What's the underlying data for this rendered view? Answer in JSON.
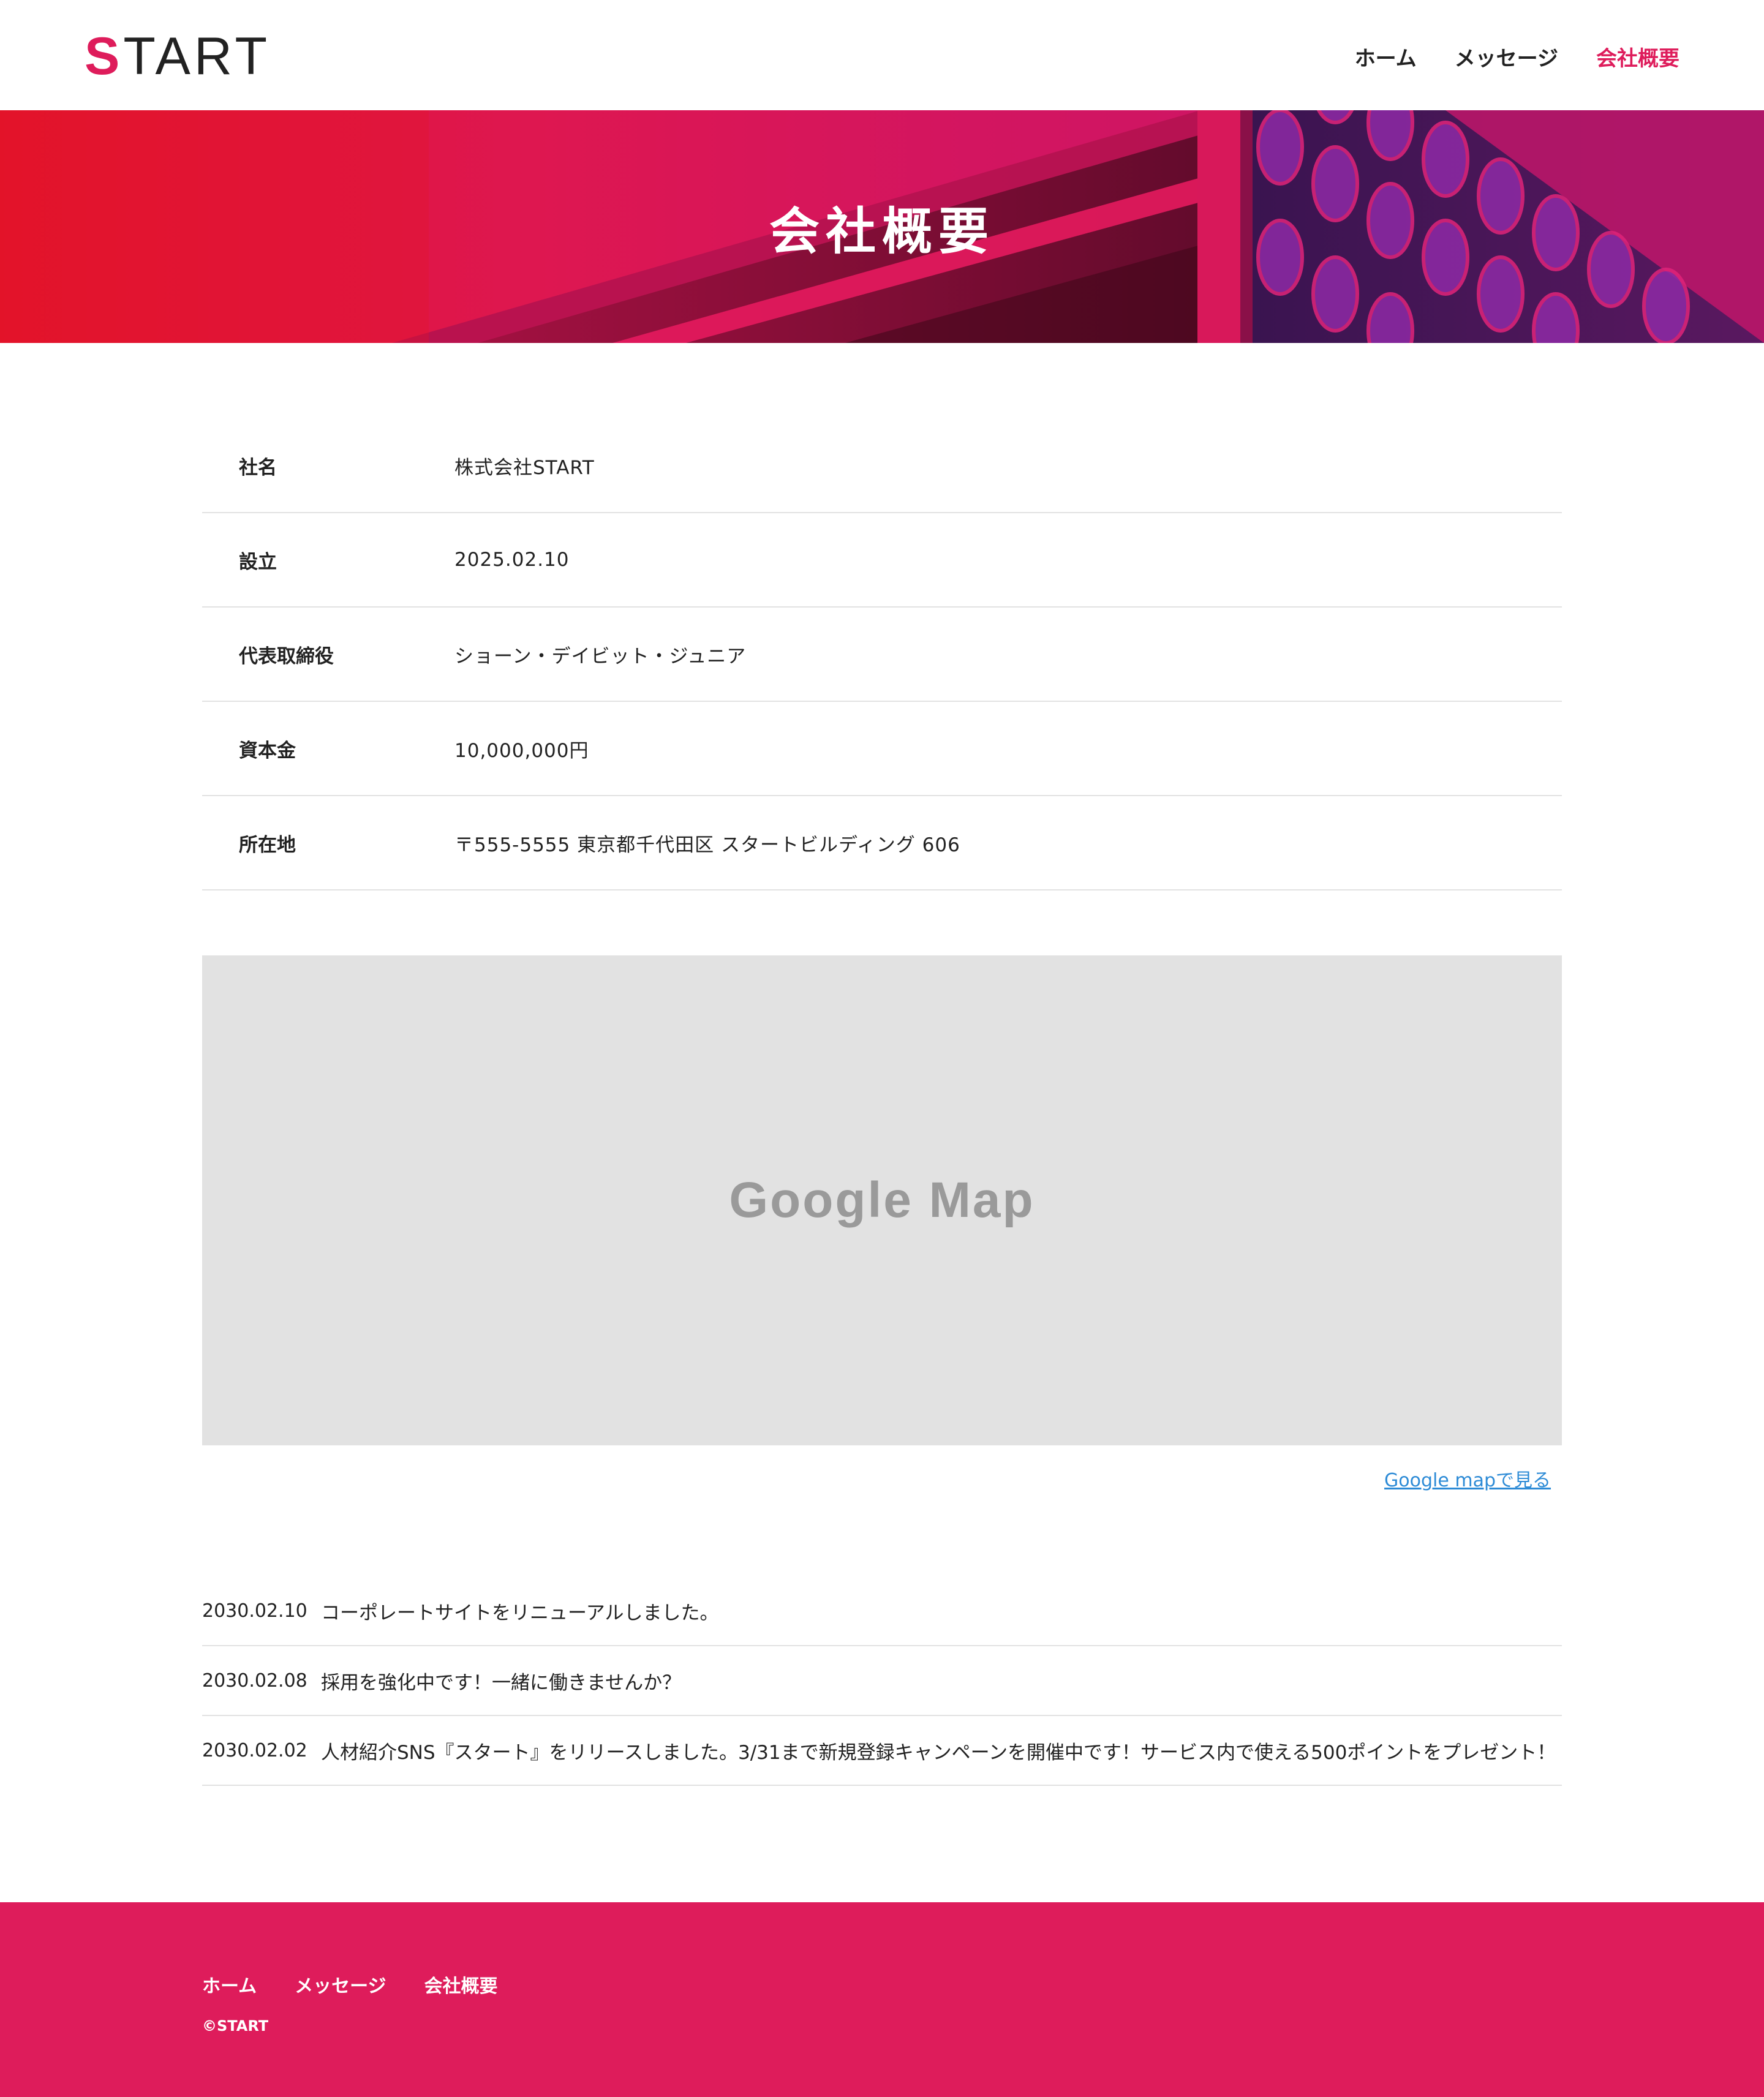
{
  "brand": {
    "logo_initial": "S",
    "logo_rest": "TART",
    "accent_color": "#de1c5b"
  },
  "nav": {
    "items": [
      {
        "label": "ホーム",
        "active": false
      },
      {
        "label": "メッセージ",
        "active": false
      },
      {
        "label": "会社概要",
        "active": true
      }
    ]
  },
  "hero": {
    "title": "会社概要"
  },
  "company_info": [
    {
      "label": "社名",
      "value": "株式会社START"
    },
    {
      "label": "設立",
      "value": "2025.02.10"
    },
    {
      "label": "代表取締役",
      "value": "ショーン・デイビット・ジュニア"
    },
    {
      "label": "資本金",
      "value": "10,000,000円"
    },
    {
      "label": "所在地",
      "value": "〒555-5555 東京都千代田区 スタートビルディング 606"
    }
  ],
  "map": {
    "placeholder": "Google Map",
    "link_label": "Google mapで見る"
  },
  "news": [
    {
      "date": "2030.02.10",
      "text": "コーポレートサイトをリニューアルしました。"
    },
    {
      "date": "2030.02.08",
      "text": "採用を強化中です！一緒に働きませんか？"
    },
    {
      "date": "2030.02.02",
      "text": "人材紹介SNS『スタート』をリリースしました。3/31まで新規登録キャンペーンを開催中です！サービス内で使える500ポイントをプレゼント！"
    }
  ],
  "footer": {
    "nav": [
      "ホーム",
      "メッセージ",
      "会社概要"
    ],
    "copyright": "©START"
  }
}
